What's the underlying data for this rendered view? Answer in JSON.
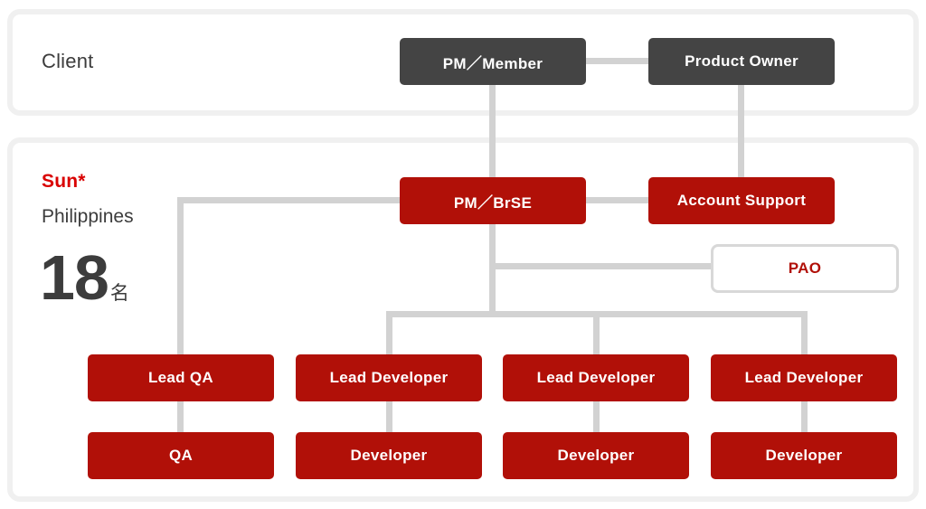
{
  "diagram": {
    "title": "Sun* Philippines project team structure",
    "colors": {
      "red": "#b11008",
      "brand_red": "#d90000",
      "dark": "#444444",
      "connector": "#d2d2d2",
      "panel_border": "#f0f0f0",
      "text_dark": "#3c3c3c"
    }
  },
  "panels": [
    {
      "id": "client",
      "label": "Client"
    },
    {
      "id": "sun",
      "brand": "Sun*",
      "region": "Philippines",
      "count": "18",
      "count_unit": "名"
    }
  ],
  "nodes": {
    "pm_member": {
      "label": "PM／Member",
      "style": "dark"
    },
    "product_owner": {
      "label": "Product Owner",
      "style": "dark"
    },
    "pm_brse": {
      "label": "PM／BrSE",
      "style": "red"
    },
    "account_support": {
      "label": "Account Support",
      "style": "red"
    },
    "pao": {
      "label": "PAO",
      "style": "ghost"
    },
    "lead_qa": {
      "label": "Lead QA",
      "style": "red"
    },
    "qa": {
      "label": "QA",
      "style": "red"
    },
    "lead_developer_1": {
      "label": "Lead Developer",
      "style": "red"
    },
    "developer_1": {
      "label": "Developer",
      "style": "red"
    },
    "lead_developer_2": {
      "label": "Lead Developer",
      "style": "red"
    },
    "developer_2": {
      "label": "Developer",
      "style": "red"
    },
    "lead_developer_3": {
      "label": "Lead Developer",
      "style": "red"
    },
    "developer_3": {
      "label": "Developer",
      "style": "red"
    }
  },
  "chart_data": {
    "type": "diagram",
    "title": "Sun* Philippines project team structure",
    "headcount": 18,
    "headcount_unit": "名",
    "groups": [
      {
        "name": "Client",
        "members": [
          "PM／Member",
          "Product Owner"
        ]
      },
      {
        "name": "Sun* Philippines",
        "members": [
          "PM／BrSE",
          "Account Support",
          "PAO",
          "Lead QA",
          "QA",
          "Lead Developer",
          "Developer",
          "Lead Developer",
          "Developer",
          "Lead Developer",
          "Developer"
        ]
      }
    ],
    "edges": [
      {
        "from": "PM／Member",
        "to": "Product Owner"
      },
      {
        "from": "PM／Member",
        "to": "PM／BrSE"
      },
      {
        "from": "Product Owner",
        "to": "Account Support"
      },
      {
        "from": "PM／BrSE",
        "to": "Account Support"
      },
      {
        "from": "PM／BrSE",
        "to": "PAO"
      },
      {
        "from": "PM／BrSE",
        "to": "Lead QA"
      },
      {
        "from": "PM／BrSE",
        "to": "Lead Developer 1"
      },
      {
        "from": "PM／BrSE",
        "to": "Lead Developer 2"
      },
      {
        "from": "PM／BrSE",
        "to": "Lead Developer 3"
      },
      {
        "from": "Lead QA",
        "to": "QA"
      },
      {
        "from": "Lead Developer 1",
        "to": "Developer 1"
      },
      {
        "from": "Lead Developer 2",
        "to": "Developer 2"
      },
      {
        "from": "Lead Developer 3",
        "to": "Developer 3"
      }
    ]
  }
}
